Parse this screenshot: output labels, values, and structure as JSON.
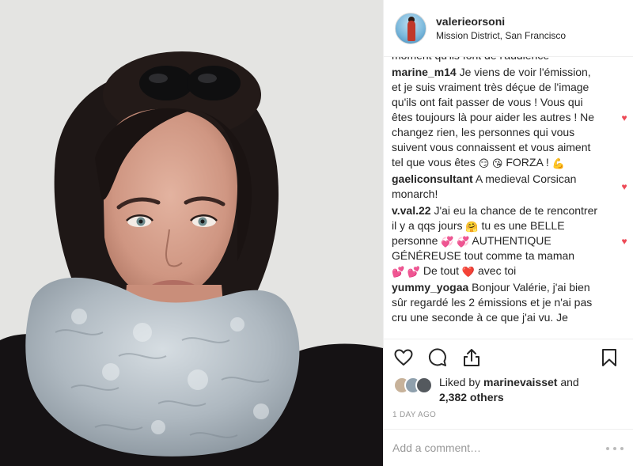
{
  "post": {
    "username": "valerieorsoni",
    "location": "Mission District, San Francisco"
  },
  "comments": {
    "cut_text": "moment qu'ils font de l'audience",
    "items": [
      {
        "user": "marine_m14",
        "text": "Je viens de voir l'émission, et je suis vraiment très déçue de l'image qu'ils ont fait passer de vous ! Vous qui êtes toujours là pour aider les autres ! Ne changez rien, les personnes qui vous suivent vous connaissent et vous aiment tel que vous êtes",
        "emojis": "😏 😘",
        "tail": "FORZA !",
        "tail_emoji": "💪",
        "liked": true
      },
      {
        "user": "gaeliconsultant",
        "text": "A medieval Corsican monarch!",
        "liked": true
      },
      {
        "user": "v.val.22",
        "text_a": "J'ai eu la chance de te rencontrer il y a qqs jours",
        "emoji_a": "🤗",
        "text_b": "tu es une BELLE personne",
        "emoji_b": "💞 💞",
        "text_c": "AUTHENTIQUE GÉNÉREUSE tout comme ta maman",
        "emoji_c": "💕 💕",
        "text_d": "De tout",
        "emoji_d": "❤️",
        "text_e": "avec toi",
        "liked": true
      },
      {
        "user": "yummy_yogaa",
        "text": "Bonjour Valérie, j'ai bien sûr regardé les 2 émissions et je n'ai pas cru une seconde à ce que j'ai vu. Je",
        "liked": false
      }
    ],
    "heart_glyph": "♥"
  },
  "actions": {
    "icons": [
      "heart-outline-icon",
      "comment-bubble-icon",
      "share-icon",
      "bookmark-icon"
    ]
  },
  "likes": {
    "prefix": "Liked by",
    "user": "marinevaisset",
    "conj": "and",
    "others": "2,382 others"
  },
  "timestamp": "1 day ago",
  "comment_box": {
    "placeholder": "Add a comment…"
  },
  "colors": {
    "like_red": "#ed4956",
    "text": "#262626",
    "muted": "#999999",
    "divider": "#efefef"
  }
}
